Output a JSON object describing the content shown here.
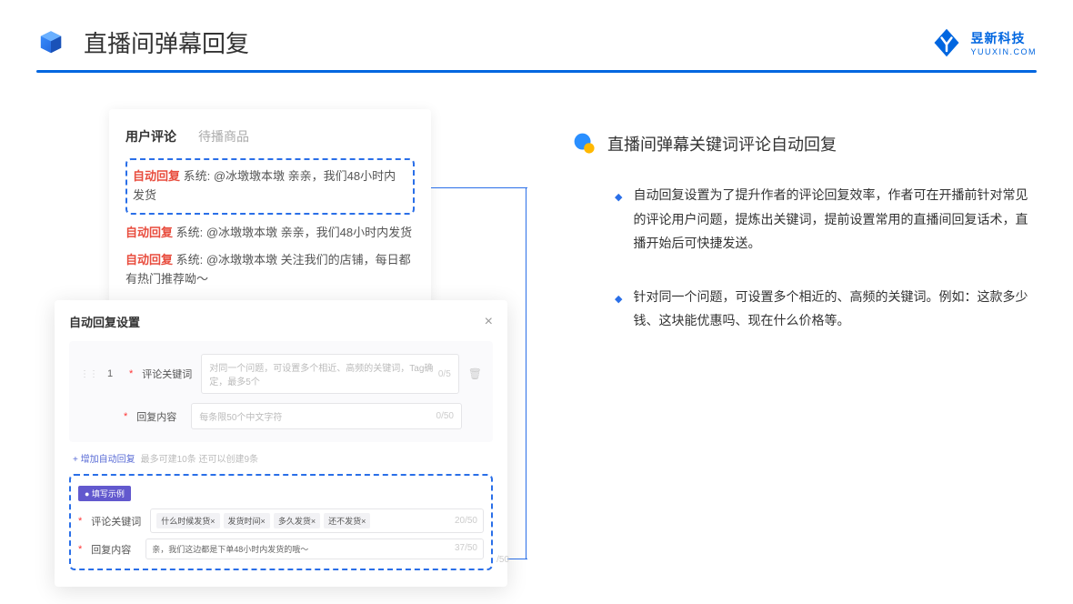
{
  "header": {
    "title": "直播间弹幕回复",
    "logo_cn": "昱新科技",
    "logo_en": "YUUXIN.COM"
  },
  "comments": {
    "tab_active": "用户评论",
    "tab_inactive": "待播商品",
    "highlight": {
      "tag": "自动回复",
      "text": " 系统: @冰墩墩本墩 亲亲，我们48小时内发货"
    },
    "row2": {
      "tag": "自动回复",
      "text": " 系统: @冰墩墩本墩 亲亲，我们48小时内发货"
    },
    "row3": {
      "tag": "自动回复",
      "text": " 系统: @冰墩墩本墩 关注我们的店铺，每日都有热门推荐呦～"
    }
  },
  "modal": {
    "title": "自动回复设置",
    "num": "1",
    "label_keyword": "评论关键词",
    "placeholder_keyword": "对同一个问题，可设置多个相近、高频的关键词，Tag确定，最多5个",
    "count_keyword": "0/5",
    "label_content": "回复内容",
    "placeholder_content": "每条限50个中文字符",
    "count_content": "0/50",
    "add_link": "+ 增加自动回复",
    "add_hint": "最多可建10条 还可以创建9条",
    "example_badge": "● 填写示例",
    "ex_label_keyword": "评论关键词",
    "ex_tags": [
      "什么时候发货×",
      "发货时间×",
      "多久发货×",
      "还不发货×"
    ],
    "ex_count_keyword": "20/50",
    "ex_label_content": "回复内容",
    "ex_content": "亲，我们这边都是下单48小时内发货的哦～",
    "ex_count_content": "37/50",
    "ex_suffix": "/50"
  },
  "info": {
    "title": "直播间弹幕关键词评论自动回复",
    "bullet1": "自动回复设置为了提升作者的评论回复效率，作者可在开播前针对常见的评论用户问题，提炼出关键词，提前设置常用的直播间回复话术，直播开始后可快捷发送。",
    "bullet2": "针对同一个问题，可设置多个相近的、高频的关键词。例如：这款多少钱、这块能优惠吗、现在什么价格等。"
  }
}
